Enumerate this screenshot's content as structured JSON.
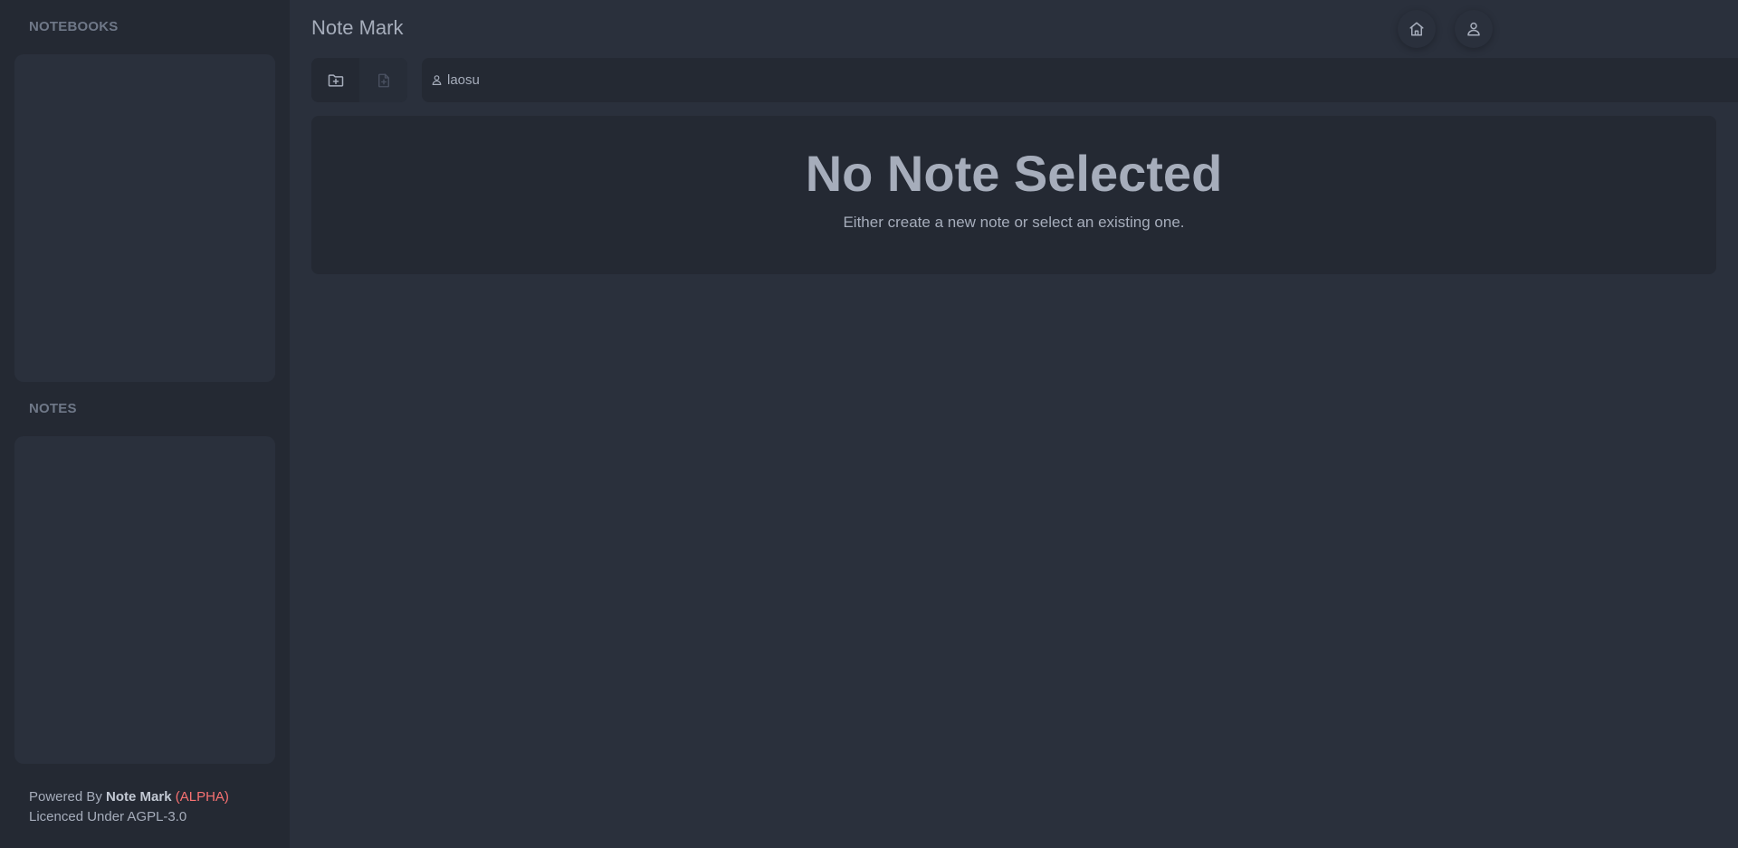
{
  "sidebar": {
    "notebooks_heading": "NOTEBOOKS",
    "notes_heading": "NOTES",
    "footer": {
      "powered_by": "Powered By",
      "brand": "Note Mark",
      "alpha": "(ALPHA)",
      "licence": "Licenced Under AGPL-3.0"
    }
  },
  "header": {
    "title": "Note Mark",
    "icons": [
      "home-icon",
      "user-icon"
    ]
  },
  "toolbar": {
    "icons": [
      "folder-plus-icon",
      "file-plus-icon"
    ],
    "breadcrumb_user": "laosu"
  },
  "main": {
    "empty_title": "No Note Selected",
    "empty_subtitle": "Either create a new note or select an existing one."
  },
  "colors": {
    "background": "#2a303c",
    "sidebar": "#242933",
    "text": "#a6adbb",
    "alpha": "#f87272"
  }
}
